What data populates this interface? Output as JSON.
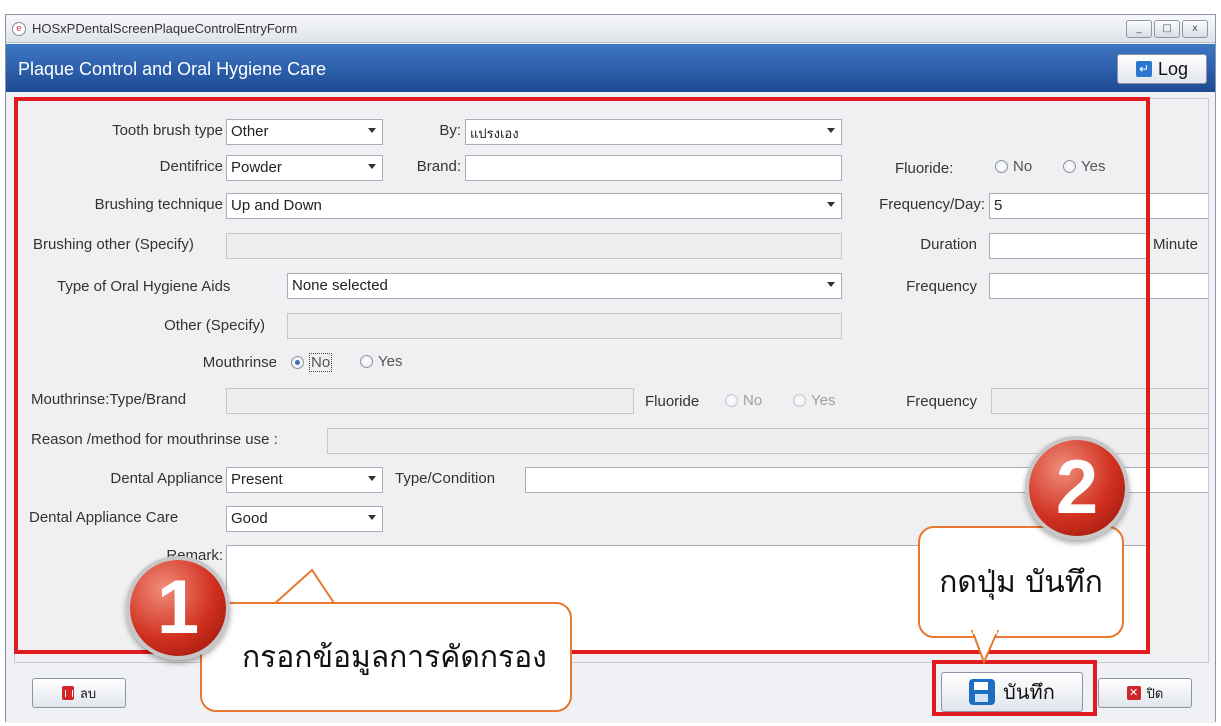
{
  "window": {
    "title": "HOSxPDentalScreenPlaqueControlEntryForm",
    "buttons": {
      "minimize": "_",
      "maximize": "□",
      "close": "x"
    }
  },
  "header": {
    "title": "Plaque Control and Oral Hygiene Care",
    "log_label": "Log",
    "log_icon": "↵"
  },
  "form": {
    "toothbrush_type_label": "Tooth brush type",
    "toothbrush_type_value": "Other",
    "by_label": "By:",
    "by_value": "แปรงเอง",
    "dentifrice_label": "Dentifrice",
    "dentifrice_value": "Powder",
    "brand_label": "Brand:",
    "brand_value": "",
    "fluoride_label": "Fluoride:",
    "fluoride_no": "No",
    "fluoride_yes": "Yes",
    "brushing_technique_label": "Brushing technique",
    "brushing_technique_value": "Up and Down",
    "frequency_day_label": "Frequency/Day:",
    "frequency_day_value": "5",
    "brushing_other_label": "Brushing other (Specify)",
    "duration_label": "Duration",
    "minute_label": "Minute",
    "oral_aids_label": "Type of Oral Hygiene Aids",
    "oral_aids_value": "None selected",
    "frequency_label": "Frequency",
    "other_specify_label": "Other (Specify)",
    "mouthrinse_label": "Mouthrinse",
    "mouthrinse_no": "No",
    "mouthrinse_yes": "Yes",
    "mouthrinse_type_label": "Mouthrinse:Type/Brand",
    "mouthrinse_fluoride_label": "Fluoride",
    "mouthrinse_fluoride_no": "No",
    "mouthrinse_fluoride_yes": "Yes",
    "mouthrinse_frequency_label": "Frequency",
    "reason_label": "Reason /method for mouthrinse use :",
    "dental_appliance_label": "Dental Appliance",
    "dental_appliance_value": "Present",
    "type_condition_label": "Type/Condition",
    "appliance_care_label": "Dental Appliance Care",
    "appliance_care_value": "Good",
    "remark_label": "Remark:"
  },
  "footer": {
    "delete_label": "ลบ",
    "save_label": "บันทึก",
    "close_label": "ปิด",
    "close_icon": "✕"
  },
  "annotations": {
    "step1_number": "1",
    "step1_text": "กรอกข้อมูลการคัดกรอง",
    "step2_number": "2",
    "step2_text": "กดปุ่ม บันทึก",
    "highlight_color": "#e11b22",
    "callout_border_color": "#e6782f"
  }
}
